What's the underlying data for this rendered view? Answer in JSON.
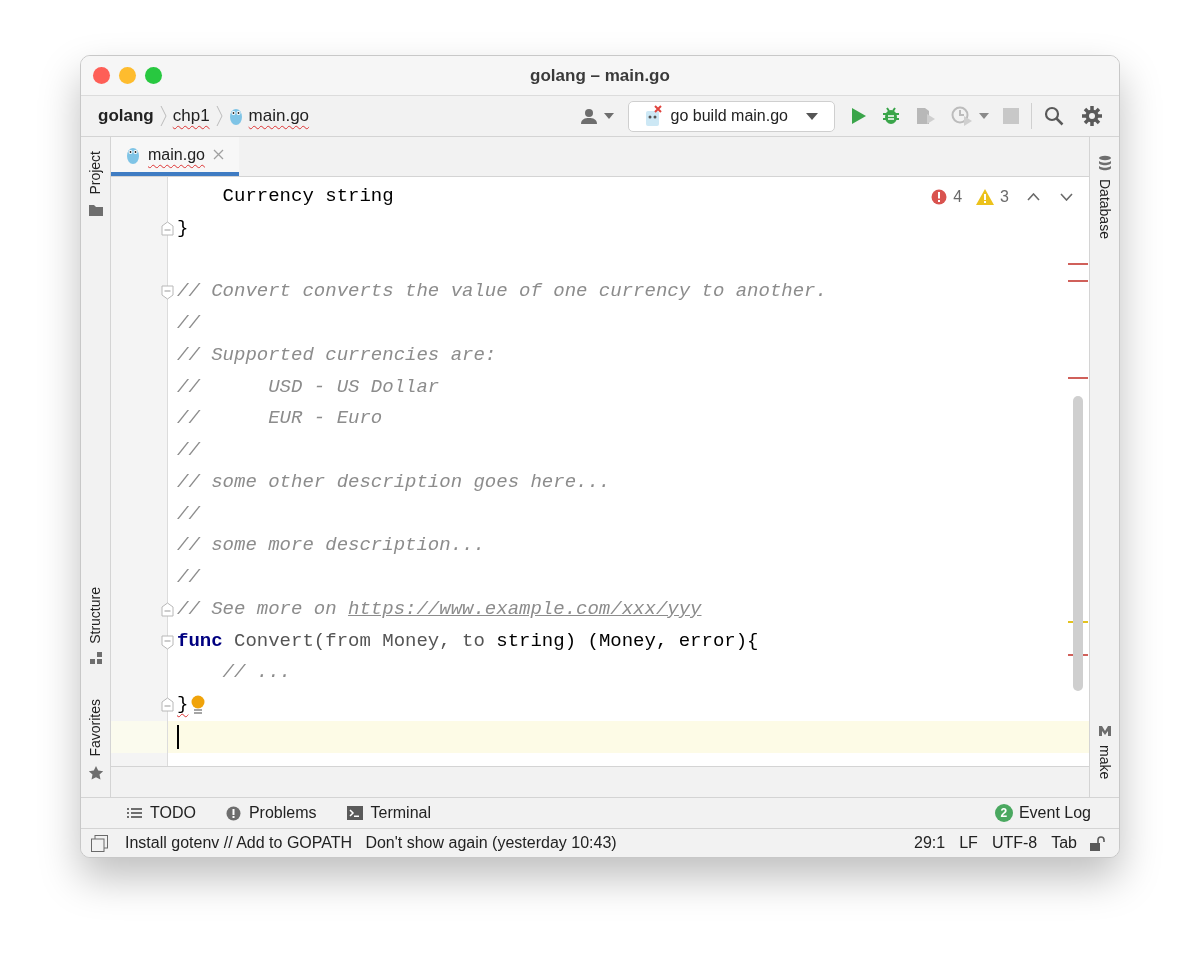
{
  "window": {
    "title": "golang – main.go"
  },
  "breadcrumbs": [
    {
      "label": "golang",
      "kind": "project",
      "misspelled": false
    },
    {
      "label": "chp1",
      "kind": "folder",
      "misspelled": true
    },
    {
      "label": "main.go",
      "kind": "file",
      "misspelled": true
    }
  ],
  "run_config": {
    "label": "go build main.go"
  },
  "tabs": [
    {
      "label": "main.go",
      "selected": true,
      "misspelled": true
    }
  ],
  "left_tools": [
    {
      "label": "Project",
      "kind": "folder"
    },
    {
      "label": "Structure",
      "kind": "structure"
    },
    {
      "label": "Favorites",
      "kind": "star"
    }
  ],
  "right_tools": [
    {
      "label": "Database",
      "kind": "database"
    },
    {
      "label": "make",
      "kind": "make"
    }
  ],
  "inspections": {
    "errors": "4",
    "warnings": "3"
  },
  "lines": [
    {
      "tokens": [
        {
          "kind": "plain",
          "text": "    Currency string"
        }
      ]
    },
    {
      "fold_end": true,
      "tokens": [
        {
          "kind": "plain",
          "text": "}"
        }
      ]
    },
    {
      "blank_line_before": true,
      "fold_start": true,
      "tokens": [
        {
          "kind": "comment",
          "text": "// Convert converts the value of one currency to another."
        }
      ]
    },
    {
      "tokens": [
        {
          "kind": "comment",
          "text": "//"
        }
      ]
    },
    {
      "tokens": [
        {
          "kind": "comment",
          "text": "// Supported currencies are:"
        }
      ]
    },
    {
      "tokens": [
        {
          "kind": "comment",
          "text": "//      USD - US Dollar"
        }
      ]
    },
    {
      "tokens": [
        {
          "kind": "comment",
          "text": "//      EUR - Euro"
        }
      ]
    },
    {
      "tokens": [
        {
          "kind": "comment",
          "text": "//"
        }
      ]
    },
    {
      "tokens": [
        {
          "kind": "comment",
          "text": "// some other description goes here..."
        }
      ]
    },
    {
      "tokens": [
        {
          "kind": "comment",
          "text": "//"
        }
      ]
    },
    {
      "tokens": [
        {
          "kind": "comment",
          "text": "// some more description..."
        }
      ]
    },
    {
      "tokens": [
        {
          "kind": "comment",
          "text": "//"
        }
      ]
    },
    {
      "fold_end": true,
      "tokens": [
        {
          "kind": "comment",
          "text": "// See more on "
        },
        {
          "kind": "link",
          "text": "https://www.example.com/xxx/yyy"
        }
      ]
    },
    {
      "fold_start": true,
      "tokens": [
        {
          "kind": "keyword",
          "text": "func"
        },
        {
          "kind": "ident",
          "text": " Convert(from Money, to"
        },
        {
          "kind": "plain",
          "text": " string) (Money, error){"
        }
      ]
    },
    {
      "tokens": [
        {
          "kind": "comment",
          "text": "    // ..."
        }
      ]
    },
    {
      "fold_end": true,
      "bulb": true,
      "tokens": [
        {
          "kind": "error",
          "text": "}"
        }
      ]
    },
    {
      "current": true,
      "caret": true
    }
  ],
  "tool_windows": [
    {
      "label": "TODO",
      "kind": "list"
    },
    {
      "label": "Problems",
      "kind": "problems"
    },
    {
      "label": "Terminal",
      "kind": "terminal"
    }
  ],
  "event_log": {
    "label": "Event Log",
    "count": "2"
  },
  "status_bar": {
    "message": "Install gotenv // Add to GOPATH   Don't show again (yesterday 10:43)",
    "position": "29:1",
    "line_separator": "LF",
    "encoding": "UTF-8",
    "indent": "Tab",
    "locked": false
  }
}
